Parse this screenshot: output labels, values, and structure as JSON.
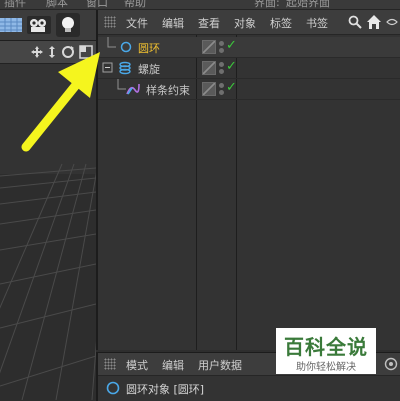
{
  "top_menu": {
    "items": [
      "插件",
      "脚本",
      "窗口",
      "帮助",
      "界面:",
      "起始界面"
    ]
  },
  "object_manager": {
    "menu": [
      "文件",
      "编辑",
      "查看",
      "对象",
      "标签",
      "书签"
    ],
    "objects": [
      {
        "name": "圆环",
        "icon": "circle-spline-icon",
        "color": "#f0c030",
        "selected": true
      },
      {
        "name": "螺旋",
        "icon": "helix-spline-icon",
        "color": "#c8c8c8",
        "selected": false
      },
      {
        "name": "样条约束",
        "icon": "spline-wrap-deformer-icon",
        "color": "#c8c8c8",
        "selected": false
      }
    ]
  },
  "attribute_manager": {
    "menu": [
      "模式",
      "编辑",
      "用户数据"
    ],
    "object_title": "圆环对象 [圆环]"
  },
  "watermark": {
    "title": "百科全说",
    "subtitle": "助你轻松解决"
  },
  "colors": {
    "accent_selected": "#f0c030",
    "check_green": "#3cc83c",
    "annotation_arrow": "#f5f51e",
    "object_icon_blue": "#4aa8e8"
  }
}
